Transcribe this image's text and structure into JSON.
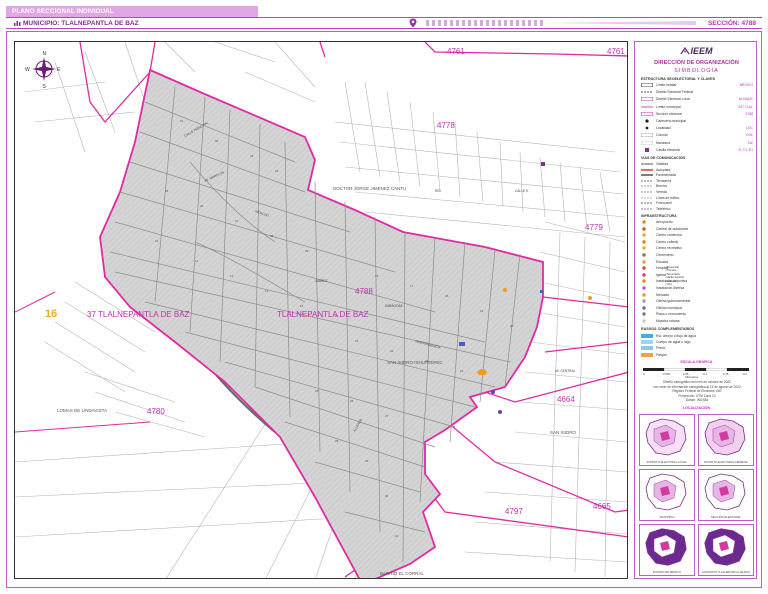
{
  "header": {
    "plan_title": "PLANO SECCIONAL INDIVIDUAL",
    "municipality": "MUNICIPIO: TLALNEPANTLA DE BAZ",
    "section": "SECCIÓN: 4788"
  },
  "map": {
    "district_label": "16",
    "municipality_label": "37 TLALNEPANTLA DE BAZ",
    "municipality_inner_label": "TLALNEPANTLA DE BAZ",
    "main_section": "4788",
    "adjacent_sections": [
      "4761",
      "4778",
      "4779",
      "4780",
      "4664",
      "4797",
      "4665"
    ],
    "colonies": [
      "DOCTOR JORGE JIMENEZ CANTU",
      "SAN ISIDRO IXHUATEPEC",
      "LOMAS DE LINDAVISTA",
      "SAN ISIDRO",
      "BARRIO EL CORRAL"
    ],
    "compass": {
      "n": "N",
      "s": "S",
      "e": "E",
      "w": "W"
    },
    "colors": {
      "section_border": "#e02aa4",
      "section_fill": "#d6d6d6",
      "streets": "#9a9a9a",
      "frame": "#c15ccb"
    }
  },
  "legend": {
    "logo": "IEEM",
    "org_caption": "Instituto Electoral del Estado de México",
    "title": "DIRECCIÓN DE ORGANIZACIÓN",
    "subtitle": "SIMBOLOGÍA",
    "structure_header": "ESTRUCTURA GEOELECTORAL Y CLAVES",
    "structure_items": [
      {
        "label": "Límite estatal",
        "code": "MÉXICO"
      },
      {
        "label": "Distrito Electoral Federal",
        "code": ""
      },
      {
        "label": "Distrito Electoral Local",
        "code": "16 NAUC"
      },
      {
        "label": "Límite municipal",
        "code": "037 TLAL"
      },
      {
        "label": "Sección electoral",
        "code": "4788"
      },
      {
        "label": "Cabecera municipal",
        "code": ""
      },
      {
        "label": "Localidad",
        "code": "LOC"
      },
      {
        "label": "Colonia",
        "code": "COL"
      },
      {
        "label": "Manzana",
        "code": "MZ"
      },
      {
        "label": "Casilla electoral",
        "code": "B, C1, E1"
      }
    ],
    "roads_header": "VÍAS DE COMUNICACIÓN",
    "road_items": [
      "Vialidad",
      "Autopista",
      "Pavimentada",
      "Terracería",
      "Brecha",
      "Vereda",
      "Línea de tráfico",
      "Ferrocarril",
      "Teleférico"
    ],
    "infra_header": "INFRAESTRUCTURA",
    "infra_items": [
      "Aeropuerto",
      "Central de autobuses",
      "Centro comercial",
      "Centro cultural",
      "Centro recreativo",
      "Cementerio",
      "Escuela",
      "Hospital",
      "Iglesia",
      "Instalación deportiva",
      "Instalación diversa",
      "Mercado",
      "Oficina gubernamental",
      "Oficina municipal",
      "Plaza o monumento",
      "Mancha urbana"
    ],
    "school_items": [
      "Preescolar",
      "Primaria",
      "Secundaria",
      "Media Superior",
      "Superior",
      "Otra"
    ],
    "comp_header": "RASGOS COMPLEMENTARIOS",
    "comp_items": [
      "Río, arroyo o flujo de agua",
      "Cuerpo de agua o lago",
      "Presa",
      "Parque"
    ],
    "scale_title": "ESCALA GRÁFICA",
    "scale_ticks": [
      "0",
      "0.025",
      "0.05",
      "0.1",
      "0.15",
      "0.2"
    ],
    "scale_unit": "Kilómetros",
    "notes": [
      "Diseño cartográfico del mes de octubre de 2022",
      "con corte de información cartográfica al 15 de agosto de 2022",
      "Registro Federal de Electores, INE",
      "Proyección: UTM Zona 14",
      "Datum: WGS84"
    ],
    "locations_title": "LOCALIZACIÓN",
    "location_captions": [
      "DISTRITO ELECTORAL LOCAL",
      "DISTRITO ELECTORAL FEDERAL",
      "MUNICIPIO",
      "SECCIÓN ELECTORAL",
      "ESTADO DE MÉXICO",
      "MUNICIPIO TLALNEPANTLA DE BAZ"
    ]
  }
}
